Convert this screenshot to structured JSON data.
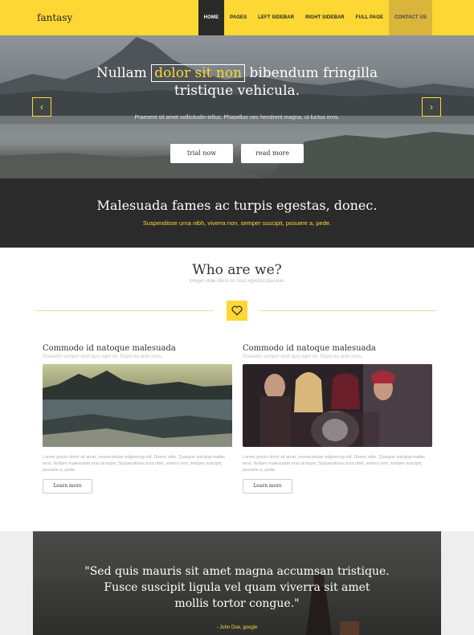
{
  "header": {
    "logo": "fantasy",
    "nav": [
      "HOME",
      "PAGES",
      "LEFT SIDEBAR",
      "RIGHT SIDEBAR",
      "FULL PAGE",
      "CONTACT US"
    ]
  },
  "hero": {
    "title_before": "Nullam",
    "title_highlight": "dolor sit non",
    "title_after": "bibendum fringilla",
    "title_line2": "tristique vehicula.",
    "subtitle": "Praesent sit amet sollicitudin tellus. Phasellus nec hendrerit magna, ut luctus eros.",
    "button_trial": "trial now",
    "button_more": "read more",
    "prev_icon": "‹",
    "next_icon": "›"
  },
  "band": {
    "title": "Malesuada fames ac turpis egestas, donec.",
    "subtitle": "Suspendisse urna nibh, viverra non, semper suscipit, posuere a, pede."
  },
  "who": {
    "title": "Who are we?",
    "subtitle": "Integer vitae libero ac risus egestas placerat.",
    "icon": "heart-icon"
  },
  "cards": [
    {
      "title": "Commodo id natoque malesuada",
      "subtitle": "Praesent semper mod quis eget mi. Etiam eu ante risus.",
      "text": "Lorem ipsum dolor sit amet, consectetuer adipiscing elit. Donec odio. Quisque volutpat mattis eros. Nullam malesuada erat ut turpis. Suspendisse urna nibh, viverra non, semper suscipit, posuere a, pede.",
      "button": "Learn more"
    },
    {
      "title": "Commodo id natoque malesuada",
      "subtitle": "Praesent semper mod quis eget mi. Etiam eu ante risus.",
      "text": "Lorem ipsum dolor sit amet, consectetuer adipiscing elit. Donec odio. Quisque volutpat mattis eros. Nullam malesuada erat ut turpis. Suspendisse urna nibh, viverra non, semper suscipit, posuere a, pede.",
      "button": "Learn more"
    }
  ],
  "quote": {
    "line1": "\"Sed quis mauris sit amet magna accumsan tristique.",
    "line2": "Fusce suscipit ligula vel quam viverra sit amet",
    "line3": "mollis tortor congue.\"",
    "author": "- John Doe, google"
  },
  "colors": {
    "accent": "#fdd835",
    "dark": "#2b2b2b"
  }
}
